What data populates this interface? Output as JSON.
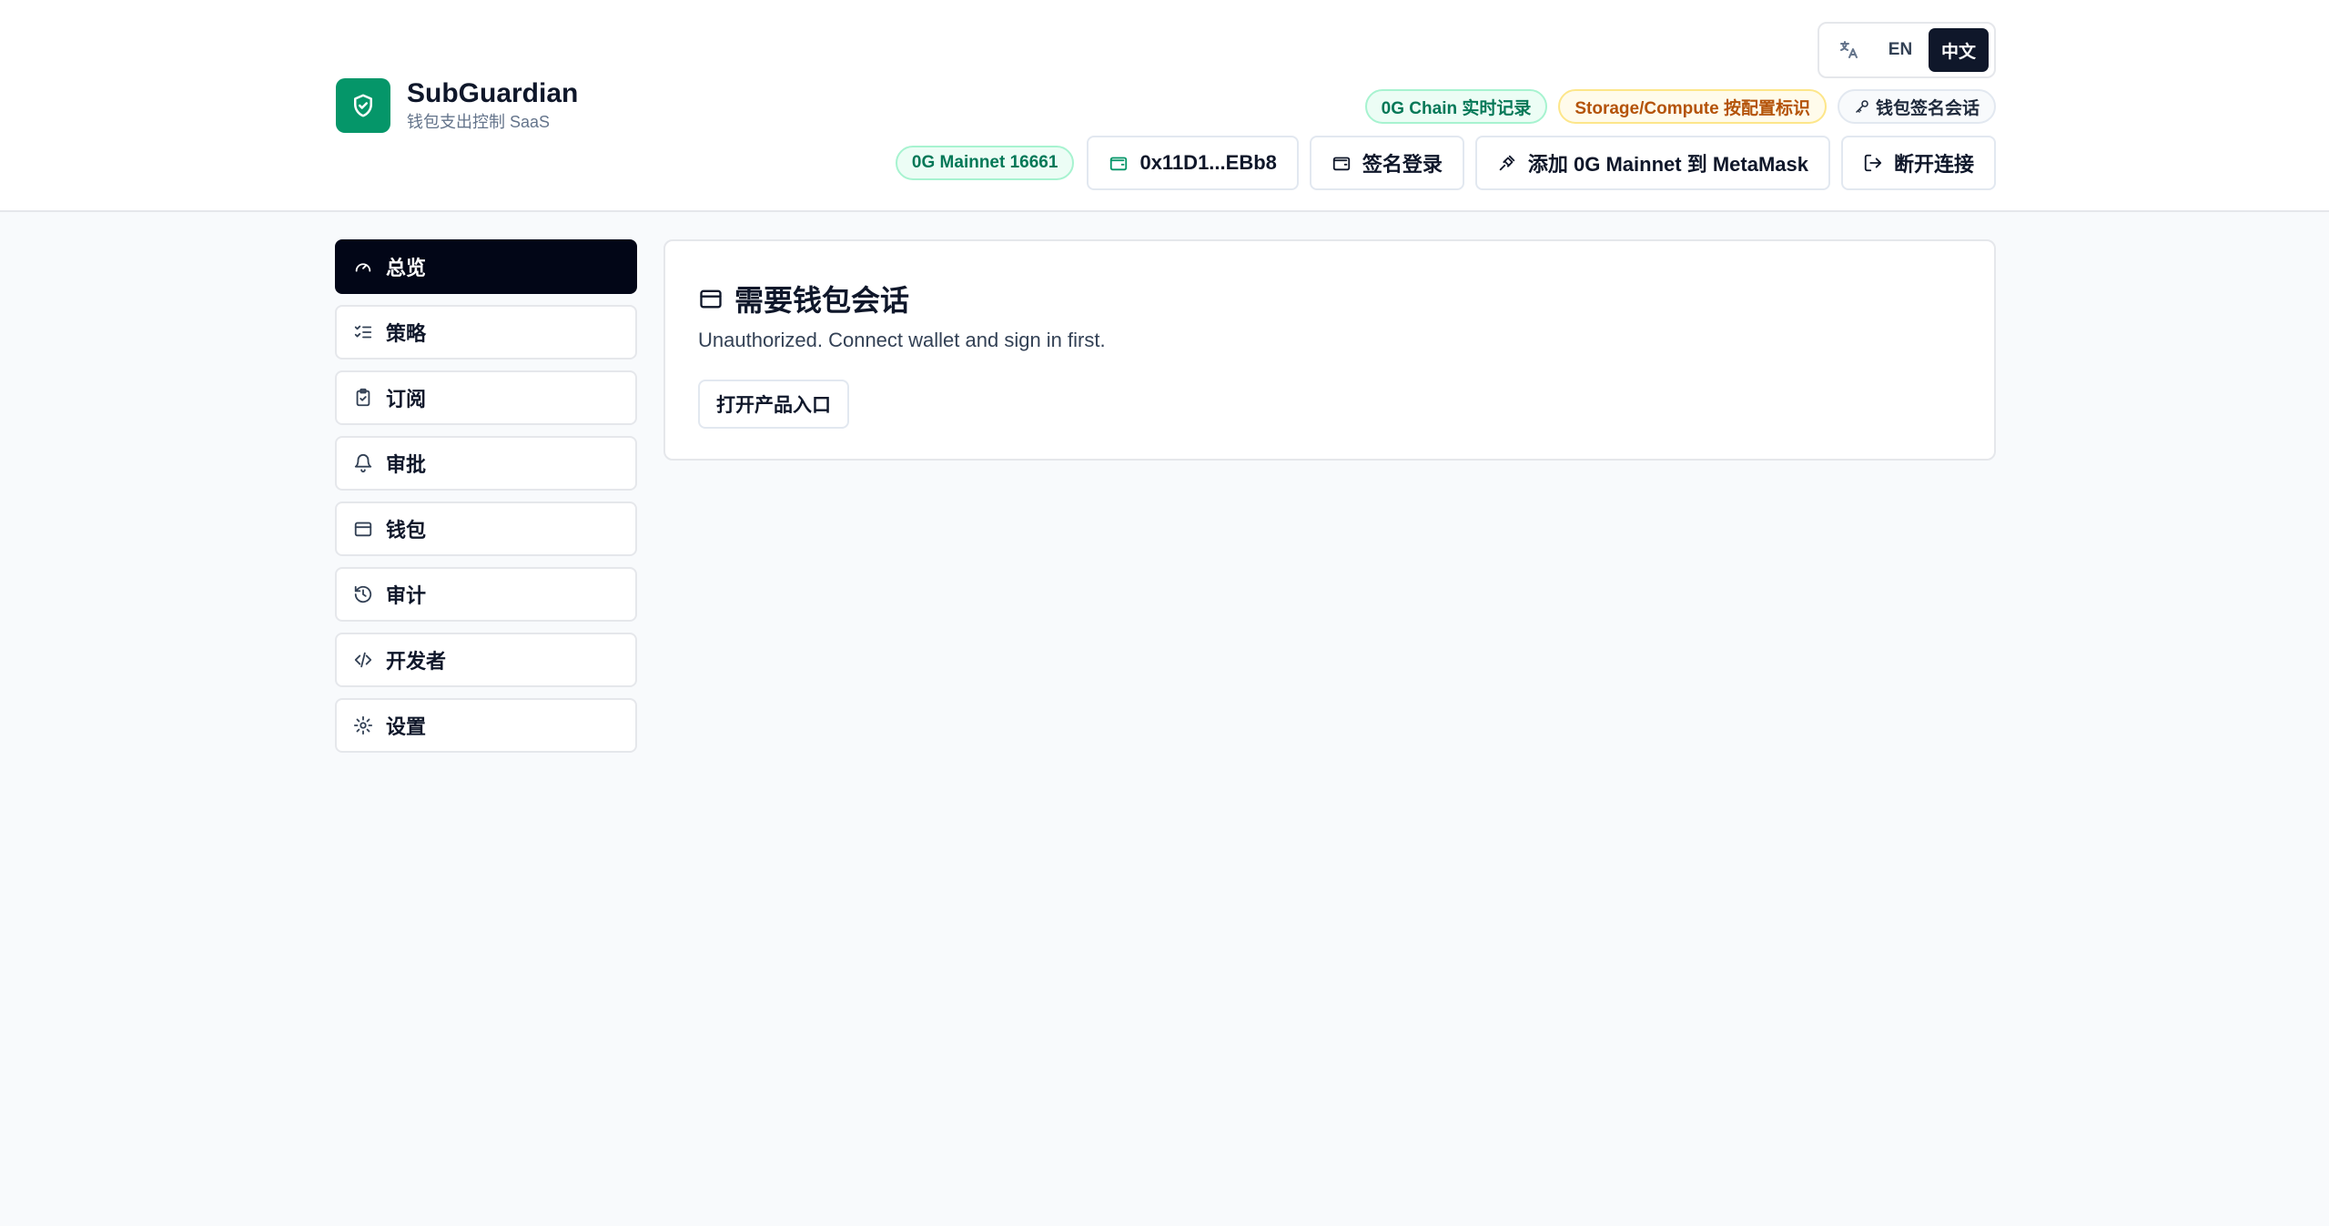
{
  "brand": {
    "title": "SubGuardian",
    "subtitle": "钱包支出控制 SaaS",
    "logo_icon": "shield-check-icon",
    "accent_color": "#059669"
  },
  "language": {
    "icon": "translate-icon",
    "options": [
      "EN",
      "中文"
    ],
    "selected": "中文"
  },
  "badges": {
    "chain": "0G Chain 实时记录",
    "storage": "Storage/Compute 按配置标识",
    "session": "钱包签名会话"
  },
  "toolbar": {
    "network": "0G Mainnet 16661",
    "wallet_address": "0x11D1...EBb8",
    "sign_in": "签名登录",
    "add_network": "添加 0G Mainnet 到 MetaMask",
    "disconnect": "断开连接"
  },
  "sidebar": {
    "items": [
      {
        "label": "总览",
        "icon": "gauge-icon",
        "active": true
      },
      {
        "label": "策略",
        "icon": "list-checks-icon"
      },
      {
        "label": "订阅",
        "icon": "clipboard-check-icon"
      },
      {
        "label": "审批",
        "icon": "bell-icon"
      },
      {
        "label": "钱包",
        "icon": "wallet-icon"
      },
      {
        "label": "审计",
        "icon": "history-icon"
      },
      {
        "label": "开发者",
        "icon": "code-icon"
      },
      {
        "label": "设置",
        "icon": "settings-icon"
      }
    ]
  },
  "main": {
    "title": "需要钱包会话",
    "message": "Unauthorized. Connect wallet and sign in first.",
    "button": "打开产品入口"
  }
}
